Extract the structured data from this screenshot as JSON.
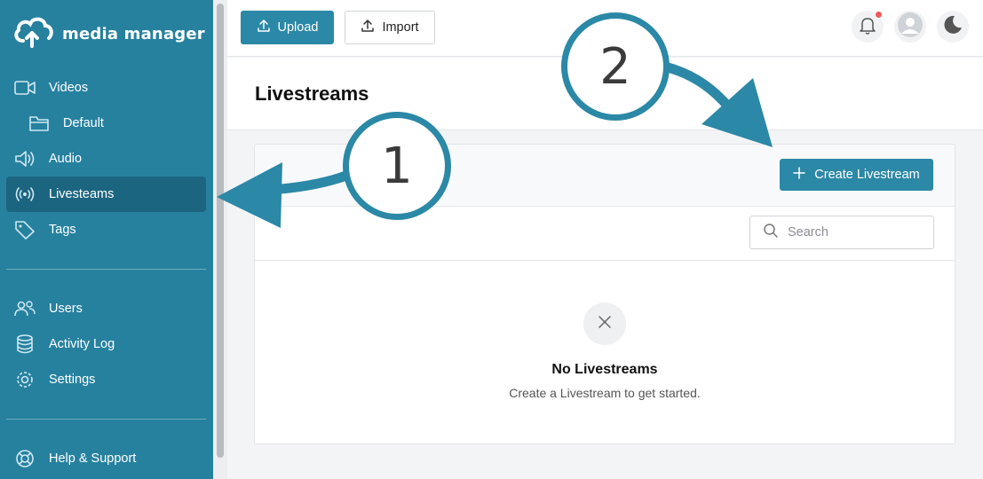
{
  "app": {
    "name": "media manager"
  },
  "sidebar": {
    "items": [
      {
        "label": "Videos",
        "icon": "video-icon"
      },
      {
        "label": "Default",
        "icon": "folder-icon"
      },
      {
        "label": "Audio",
        "icon": "speaker-icon"
      },
      {
        "label": "Livesteams",
        "icon": "broadcast-icon",
        "active": true
      },
      {
        "label": "Tags",
        "icon": "tag-icon"
      },
      {
        "label": "Users",
        "icon": "users-icon"
      },
      {
        "label": "Activity Log",
        "icon": "database-icon"
      },
      {
        "label": "Settings",
        "icon": "gear-icon"
      },
      {
        "label": "Help & Support",
        "icon": "lifebuoy-icon"
      }
    ]
  },
  "toolbar": {
    "upload_label": "Upload",
    "import_label": "Import"
  },
  "page": {
    "title": "Livestreams"
  },
  "card": {
    "create_label": "Create Livestream",
    "search_placeholder": "Search",
    "empty_title": "No Livestreams",
    "empty_subtitle": "Create a Livestream to get started."
  },
  "callouts": {
    "one": "1",
    "two": "2"
  },
  "colors": {
    "brand": "#26819f",
    "sidebar_active": "#1c6580",
    "button": "#2b88a6",
    "notification_dot": "#f05a5a"
  }
}
